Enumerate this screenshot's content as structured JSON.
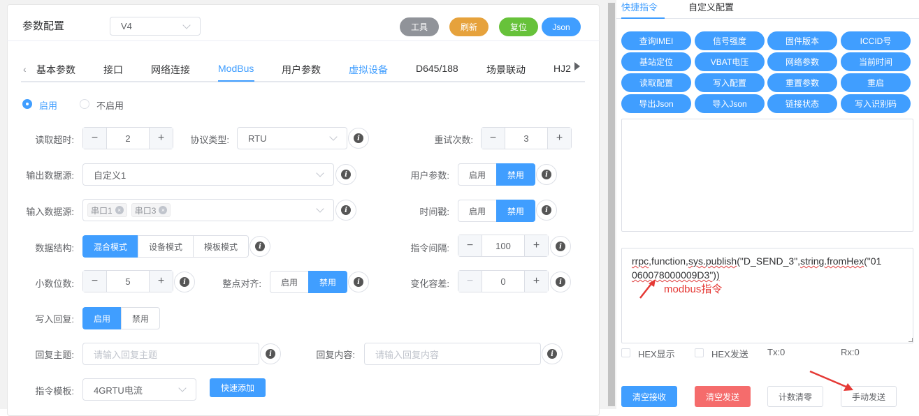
{
  "header": {
    "title": "参数配置",
    "version_select": "V4",
    "buttons": [
      {
        "label": "工具",
        "color": "#909399"
      },
      {
        "label": "刷新",
        "color": "#e6a23c"
      },
      {
        "label": "复位",
        "color": "#67c23a"
      },
      {
        "label": "Json",
        "color": "#409eff"
      }
    ]
  },
  "tabs": [
    "基本参数",
    "接口",
    "网络连接",
    "ModBus",
    "用户参数",
    "虚拟设备",
    "D645/188",
    "场景联动",
    "HJ2"
  ],
  "active_tab": "ModBus",
  "enable_radio": {
    "on": "启用",
    "off": "不启用",
    "selected": "启用"
  },
  "form": {
    "read_timeout": {
      "label": "读取超时:",
      "value": "2"
    },
    "protocol_type": {
      "label": "协议类型:",
      "value": "RTU"
    },
    "retry_count": {
      "label": "重试次数:",
      "value": "3"
    },
    "output_source": {
      "label": "输出数据源:",
      "value": "自定义1"
    },
    "user_params": {
      "label": "用户参数:",
      "on": "启用",
      "off": "禁用",
      "selected": "禁用"
    },
    "input_source": {
      "label": "输入数据源:",
      "tags": [
        "串口1",
        "串口3"
      ]
    },
    "timestamp": {
      "label": "时间戳:",
      "on": "启用",
      "off": "禁用",
      "selected": "禁用"
    },
    "data_structure": {
      "label": "数据结构:",
      "options": [
        "混合模式",
        "设备模式",
        "模板模式"
      ],
      "selected": "混合模式"
    },
    "cmd_interval": {
      "label": "指令间隔:",
      "value": "100"
    },
    "decimal_places": {
      "label": "小数位数:",
      "value": "5"
    },
    "hour_align": {
      "label": "整点对齐:",
      "on": "启用",
      "off": "禁用",
      "selected": "禁用"
    },
    "change_tolerance": {
      "label": "变化容差:",
      "value": "0"
    },
    "write_reply": {
      "label": "写入回复:",
      "on": "启用",
      "off": "禁用",
      "selected": "启用"
    },
    "reply_topic": {
      "label": "回复主题:",
      "placeholder": "请输入回复主题"
    },
    "reply_content": {
      "label": "回复内容:",
      "placeholder": "请输入回复内容"
    },
    "cmd_template": {
      "label": "指令模板:",
      "value": "4GRTU电流",
      "quick_add": "快速添加"
    }
  },
  "right": {
    "tabs": [
      "快捷指令",
      "自定义配置"
    ],
    "active_tab": "快捷指令",
    "quick_buttons": [
      "查询IMEI",
      "信号强度",
      "固件版本",
      "ICCID号",
      "基站定位",
      "VBAT电压",
      "网络参数",
      "当前时间",
      "读取配置",
      "写入配置",
      "重置参数",
      "重启",
      "导出Json",
      "导入Json",
      "链接状态",
      "写入识别码"
    ],
    "send_text_line1_a": "rrpc",
    "send_text_line1_b": ",function,",
    "send_text_line1_c": "sys.publish",
    "send_text_line1_d": "(\"D_SEND_3\",",
    "send_text_line1_e": "string.fromHex",
    "send_text_line1_f": "(\"01",
    "send_text_line2": "060078000009D3\"))",
    "annotation": "modbus指令",
    "hex_show": "HEX显示",
    "hex_send": "HEX发送",
    "tx": "Tx:0",
    "rx": "Rx:0",
    "bottom_buttons": [
      "清空接收",
      "清空发送",
      "计数清零",
      "手动发送"
    ]
  }
}
